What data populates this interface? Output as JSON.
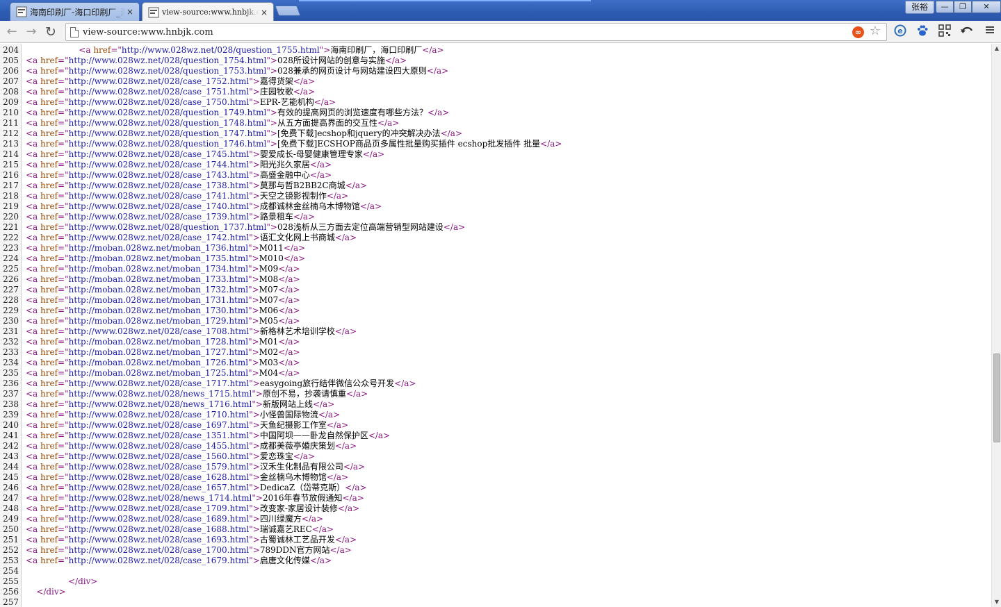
{
  "window": {
    "profile_name": "张裕",
    "minimize": "—",
    "restore": "❐",
    "close": "✕"
  },
  "tabs": [
    {
      "title": "海南印刷厂-海口印刷厂_海南",
      "close": "×",
      "active": false
    },
    {
      "title": "view-source:www.hnbjk.com",
      "close": "×",
      "active": true
    }
  ],
  "toolbar": {
    "back": "←",
    "forward": "→",
    "reload": "↻",
    "address_value": "view-source:www.hnbjk.com",
    "extension_badge": "∞",
    "bookmark_star": "☆",
    "icons": [
      "ie-icon",
      "baidu-paw-icon",
      "qr-code-icon",
      "undo-arrow-icon",
      "menu-icon"
    ]
  },
  "source": {
    "lines": [
      {
        "n": "204",
        "indent": "                    ",
        "href": "http://www.028wz.net/028/question_1755.html",
        "text": "海南印刷厂，海口印刷厂"
      },
      {
        "n": "205",
        "indent": "",
        "href": "http://www.028wz.net/028/question_1754.html",
        "text": "028所设计网站的创意与实施"
      },
      {
        "n": "206",
        "indent": "",
        "href": "http://www.028wz.net/028/question_1753.html",
        "text": "028兼承的网页设计与网站建设四大原则"
      },
      {
        "n": "207",
        "indent": "",
        "href": "http://www.028wz.net/028/case_1752.html",
        "text": "嘉得货架"
      },
      {
        "n": "208",
        "indent": "",
        "href": "http://www.028wz.net/028/case_1751.html",
        "text": "庄园牧歌"
      },
      {
        "n": "209",
        "indent": "",
        "href": "http://www.028wz.net/028/case_1750.html",
        "text": "EPR-艺能机构"
      },
      {
        "n": "210",
        "indent": "",
        "href": "http://www.028wz.net/028/question_1749.html",
        "text": "有效的提高网页的浏览速度有哪些方法？"
      },
      {
        "n": "211",
        "indent": "",
        "href": "http://www.028wz.net/028/question_1748.html",
        "text": "从五方面提高界面的交互性"
      },
      {
        "n": "212",
        "indent": "",
        "href": "http://www.028wz.net/028/question_1747.html",
        "text": "[免费下载]ecshop和jquery的冲突解决办法"
      },
      {
        "n": "213",
        "indent": "",
        "href": "http://www.028wz.net/028/question_1746.html",
        "text": "[免费下载]ECSHOP商品页多属性批量购买插件 ecshop批发插件 批量"
      },
      {
        "n": "214",
        "indent": "",
        "href": "http://www.028wz.net/028/case_1745.html",
        "text": "婴爱成长-母婴健康管理专家"
      },
      {
        "n": "215",
        "indent": "",
        "href": "http://www.028wz.net/028/case_1744.html",
        "text": "阳光兆久家居"
      },
      {
        "n": "216",
        "indent": "",
        "href": "http://www.028wz.net/028/case_1743.html",
        "text": "高盛金融中心"
      },
      {
        "n": "217",
        "indent": "",
        "href": "http://www.028wz.net/028/case_1738.html",
        "text": "莫那与哲B2BB2C商城"
      },
      {
        "n": "218",
        "indent": "",
        "href": "http://www.028wz.net/028/case_1741.html",
        "text": "天空之镜影视制作"
      },
      {
        "n": "219",
        "indent": "",
        "href": "http://www.028wz.net/028/case_1740.html",
        "text": "成都诚林金丝楠乌木博物馆"
      },
      {
        "n": "220",
        "indent": "",
        "href": "http://www.028wz.net/028/case_1739.html",
        "text": "路景租车"
      },
      {
        "n": "221",
        "indent": "",
        "href": "http://www.028wz.net/028/question_1737.html",
        "text": "028浅析从三方面去定位高端营销型网站建设"
      },
      {
        "n": "222",
        "indent": "",
        "href": "http://www.028wz.net/028/case_1742.html",
        "text": "语汇文化网上书商城"
      },
      {
        "n": "223",
        "indent": "",
        "href": "http://moban.028wz.net/moban_1736.html",
        "text": "M011"
      },
      {
        "n": "224",
        "indent": "",
        "href": "http://moban.028wz.net/moban_1735.html",
        "text": "M010"
      },
      {
        "n": "225",
        "indent": "",
        "href": "http://moban.028wz.net/moban_1734.html",
        "text": "M09"
      },
      {
        "n": "226",
        "indent": "",
        "href": "http://moban.028wz.net/moban_1733.html",
        "text": "M08"
      },
      {
        "n": "227",
        "indent": "",
        "href": "http://moban.028wz.net/moban_1732.html",
        "text": "M07"
      },
      {
        "n": "228",
        "indent": "",
        "href": "http://moban.028wz.net/moban_1731.html",
        "text": "M07"
      },
      {
        "n": "229",
        "indent": "",
        "href": "http://moban.028wz.net/moban_1730.html",
        "text": "M06"
      },
      {
        "n": "230",
        "indent": "",
        "href": "http://moban.028wz.net/moban_1729.html",
        "text": "M05"
      },
      {
        "n": "231",
        "indent": "",
        "href": "http://www.028wz.net/028/case_1708.html",
        "text": "新格林艺术培训学校"
      },
      {
        "n": "232",
        "indent": "",
        "href": "http://moban.028wz.net/moban_1728.html",
        "text": "M01"
      },
      {
        "n": "233",
        "indent": "",
        "href": "http://moban.028wz.net/moban_1727.html",
        "text": "M02"
      },
      {
        "n": "234",
        "indent": "",
        "href": "http://moban.028wz.net/moban_1726.html",
        "text": "M03"
      },
      {
        "n": "235",
        "indent": "",
        "href": "http://moban.028wz.net/moban_1725.html",
        "text": "M04"
      },
      {
        "n": "236",
        "indent": "",
        "href": "http://www.028wz.net/028/case_1717.html",
        "text": "easygoing旅行结伴微信公众号开发"
      },
      {
        "n": "237",
        "indent": "",
        "href": "http://www.028wz.net/028/news_1715.html",
        "text": "原创不易，抄袭请慎重"
      },
      {
        "n": "238",
        "indent": "",
        "href": "http://www.028wz.net/028/news_1716.html",
        "text": "新版网站上线"
      },
      {
        "n": "239",
        "indent": "",
        "href": "http://www.028wz.net/028/case_1710.html",
        "text": "小怪兽国际物流"
      },
      {
        "n": "240",
        "indent": "",
        "href": "http://www.028wz.net/028/case_1697.html",
        "text": "天鱼纪摄影工作室"
      },
      {
        "n": "241",
        "indent": "",
        "href": "http://www.028wz.net/028/case_1351.html",
        "text": "中国阿坝——卧龙自然保护区"
      },
      {
        "n": "242",
        "indent": "",
        "href": "http://www.028wz.net/028/case_1455.html",
        "text": "成都美薇亭婚庆策划"
      },
      {
        "n": "243",
        "indent": "",
        "href": "http://www.028wz.net/028/case_1560.html",
        "text": "爱恋珠宝"
      },
      {
        "n": "244",
        "indent": "",
        "href": "http://www.028wz.net/028/case_1579.html",
        "text": "汉禾生化制品有限公司"
      },
      {
        "n": "245",
        "indent": "",
        "href": "http://www.028wz.net/028/case_1628.html",
        "text": "金丝楠乌木博物馆"
      },
      {
        "n": "246",
        "indent": "",
        "href": "http://www.028wz.net/028/case_1657.html",
        "text": "DedicaZ（岱蒂克斯）"
      },
      {
        "n": "247",
        "indent": "",
        "href": "http://www.028wz.net/028/news_1714.html",
        "text": "2016年春节放假通知"
      },
      {
        "n": "248",
        "indent": "",
        "href": "http://www.028wz.net/028/case_1709.html",
        "text": "改变家-家居设计装修"
      },
      {
        "n": "249",
        "indent": "",
        "href": "http://www.028wz.net/028/case_1689.html",
        "text": "四川绿魔方"
      },
      {
        "n": "250",
        "indent": "",
        "href": "http://www.028wz.net/028/case_1688.html",
        "text": "瑞诚嘉艺REC"
      },
      {
        "n": "251",
        "indent": "",
        "href": "http://www.028wz.net/028/case_1693.html",
        "text": "古蜀诚林工艺品开发"
      },
      {
        "n": "252",
        "indent": "",
        "href": "http://www.028wz.net/028/case_1700.html",
        "text": "789DDN官方网站"
      },
      {
        "n": "253",
        "indent": "",
        "href": "http://www.028wz.net/028/case_1679.html",
        "text": "启唐文化传媒"
      },
      {
        "n": "254",
        "raw": ""
      },
      {
        "n": "255",
        "raw": "                </div>"
      },
      {
        "n": "256",
        "raw": "    </div>"
      },
      {
        "n": "257",
        "raw": ""
      }
    ]
  },
  "scrollbar": {
    "up": "▲",
    "down": "▼",
    "position_fraction": 0.66
  },
  "colors": {
    "titlebar": "#2d5bb2",
    "tag": "#881280",
    "attribute": "#994500",
    "attribute_value": "#1a1aa6",
    "line_number_gutter": "#f5f5f5"
  }
}
